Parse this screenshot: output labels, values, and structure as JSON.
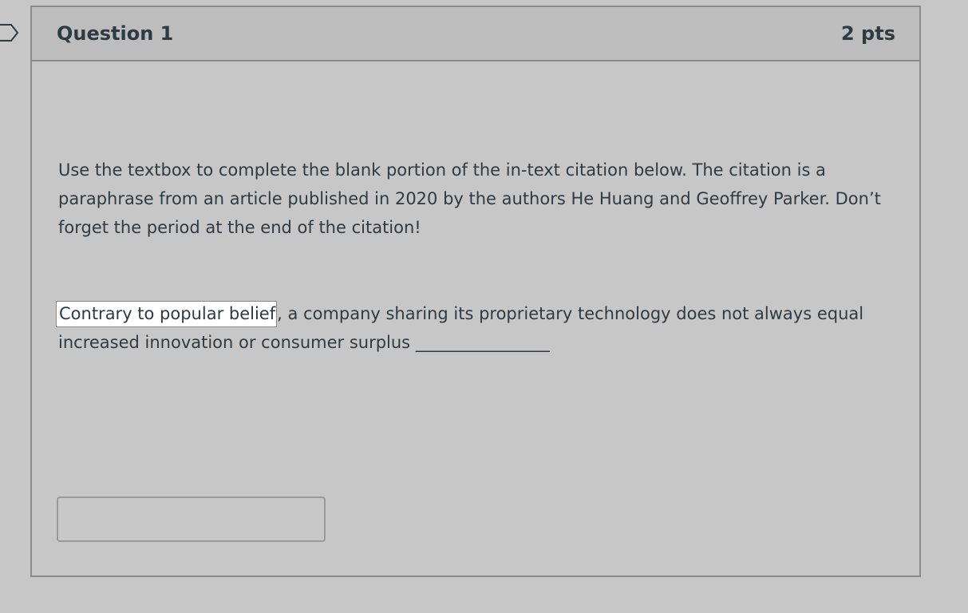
{
  "question": {
    "title": "Question 1",
    "points": "2 pts",
    "instructions": "Use the textbox to complete the blank portion of the in-text citation below. The citation is a paraphrase from an article published in 2020 by the authors He Huang and Geoffrey Parker. Don’t forget the period at the end of the citation!",
    "citation": {
      "highlighted": "Contrary to popular belief",
      "rest": ", a company sharing its proprietary technology does not always equal increased innovation or consumer surplus ________________"
    },
    "answer": {
      "value": "",
      "placeholder": ""
    }
  },
  "icons": {
    "flag": "flag-icon"
  }
}
